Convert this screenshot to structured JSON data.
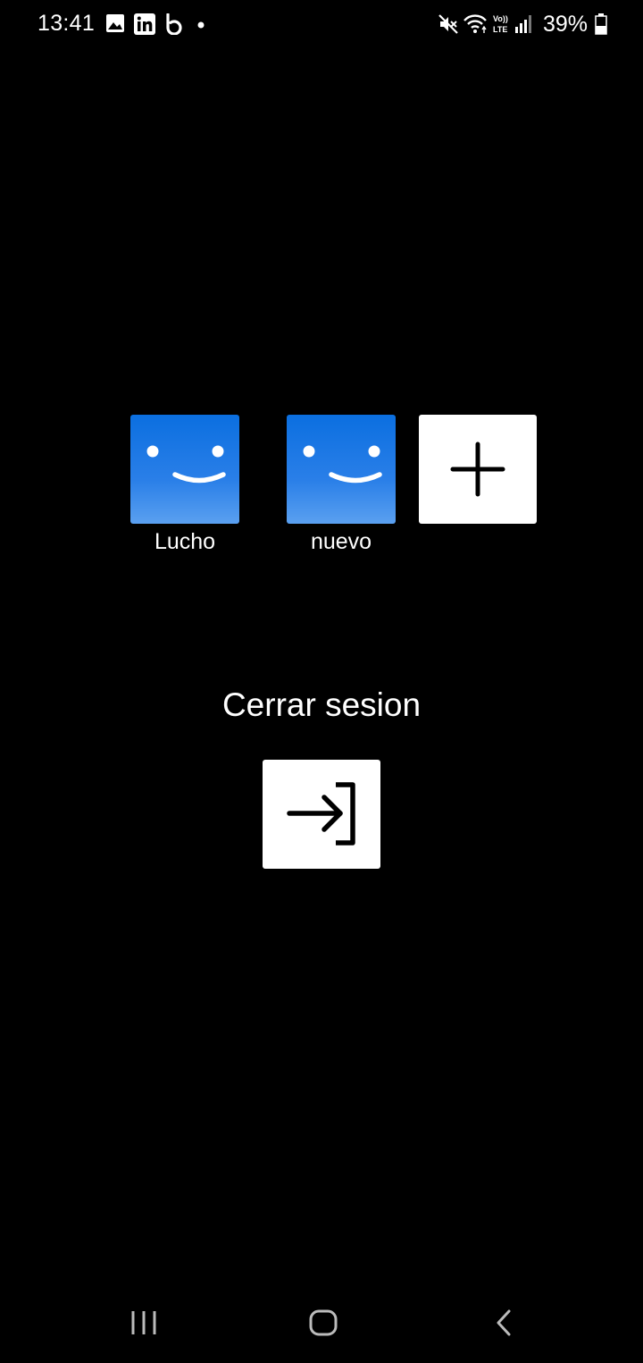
{
  "status_bar": {
    "time": "13:41",
    "battery": "39%",
    "left_icons": [
      "gallery-icon",
      "linkedin-icon",
      "b-app-icon",
      "dot-icon"
    ],
    "right_icons": [
      "mute-icon",
      "wifi-icon",
      "volte-icon",
      "signal-icon",
      "battery-icon"
    ]
  },
  "profiles": [
    {
      "name": "Lucho"
    },
    {
      "name": "nuevo"
    }
  ],
  "add_profile": {
    "icon": "plus-icon"
  },
  "logout": {
    "title": "Cerrar sesion",
    "icon": "logout-icon"
  },
  "nav": {
    "recents": "recents-icon",
    "home": "home-icon",
    "back": "back-icon"
  },
  "colors": {
    "avatar_blue": "#0b6fe0",
    "background": "#000000"
  }
}
